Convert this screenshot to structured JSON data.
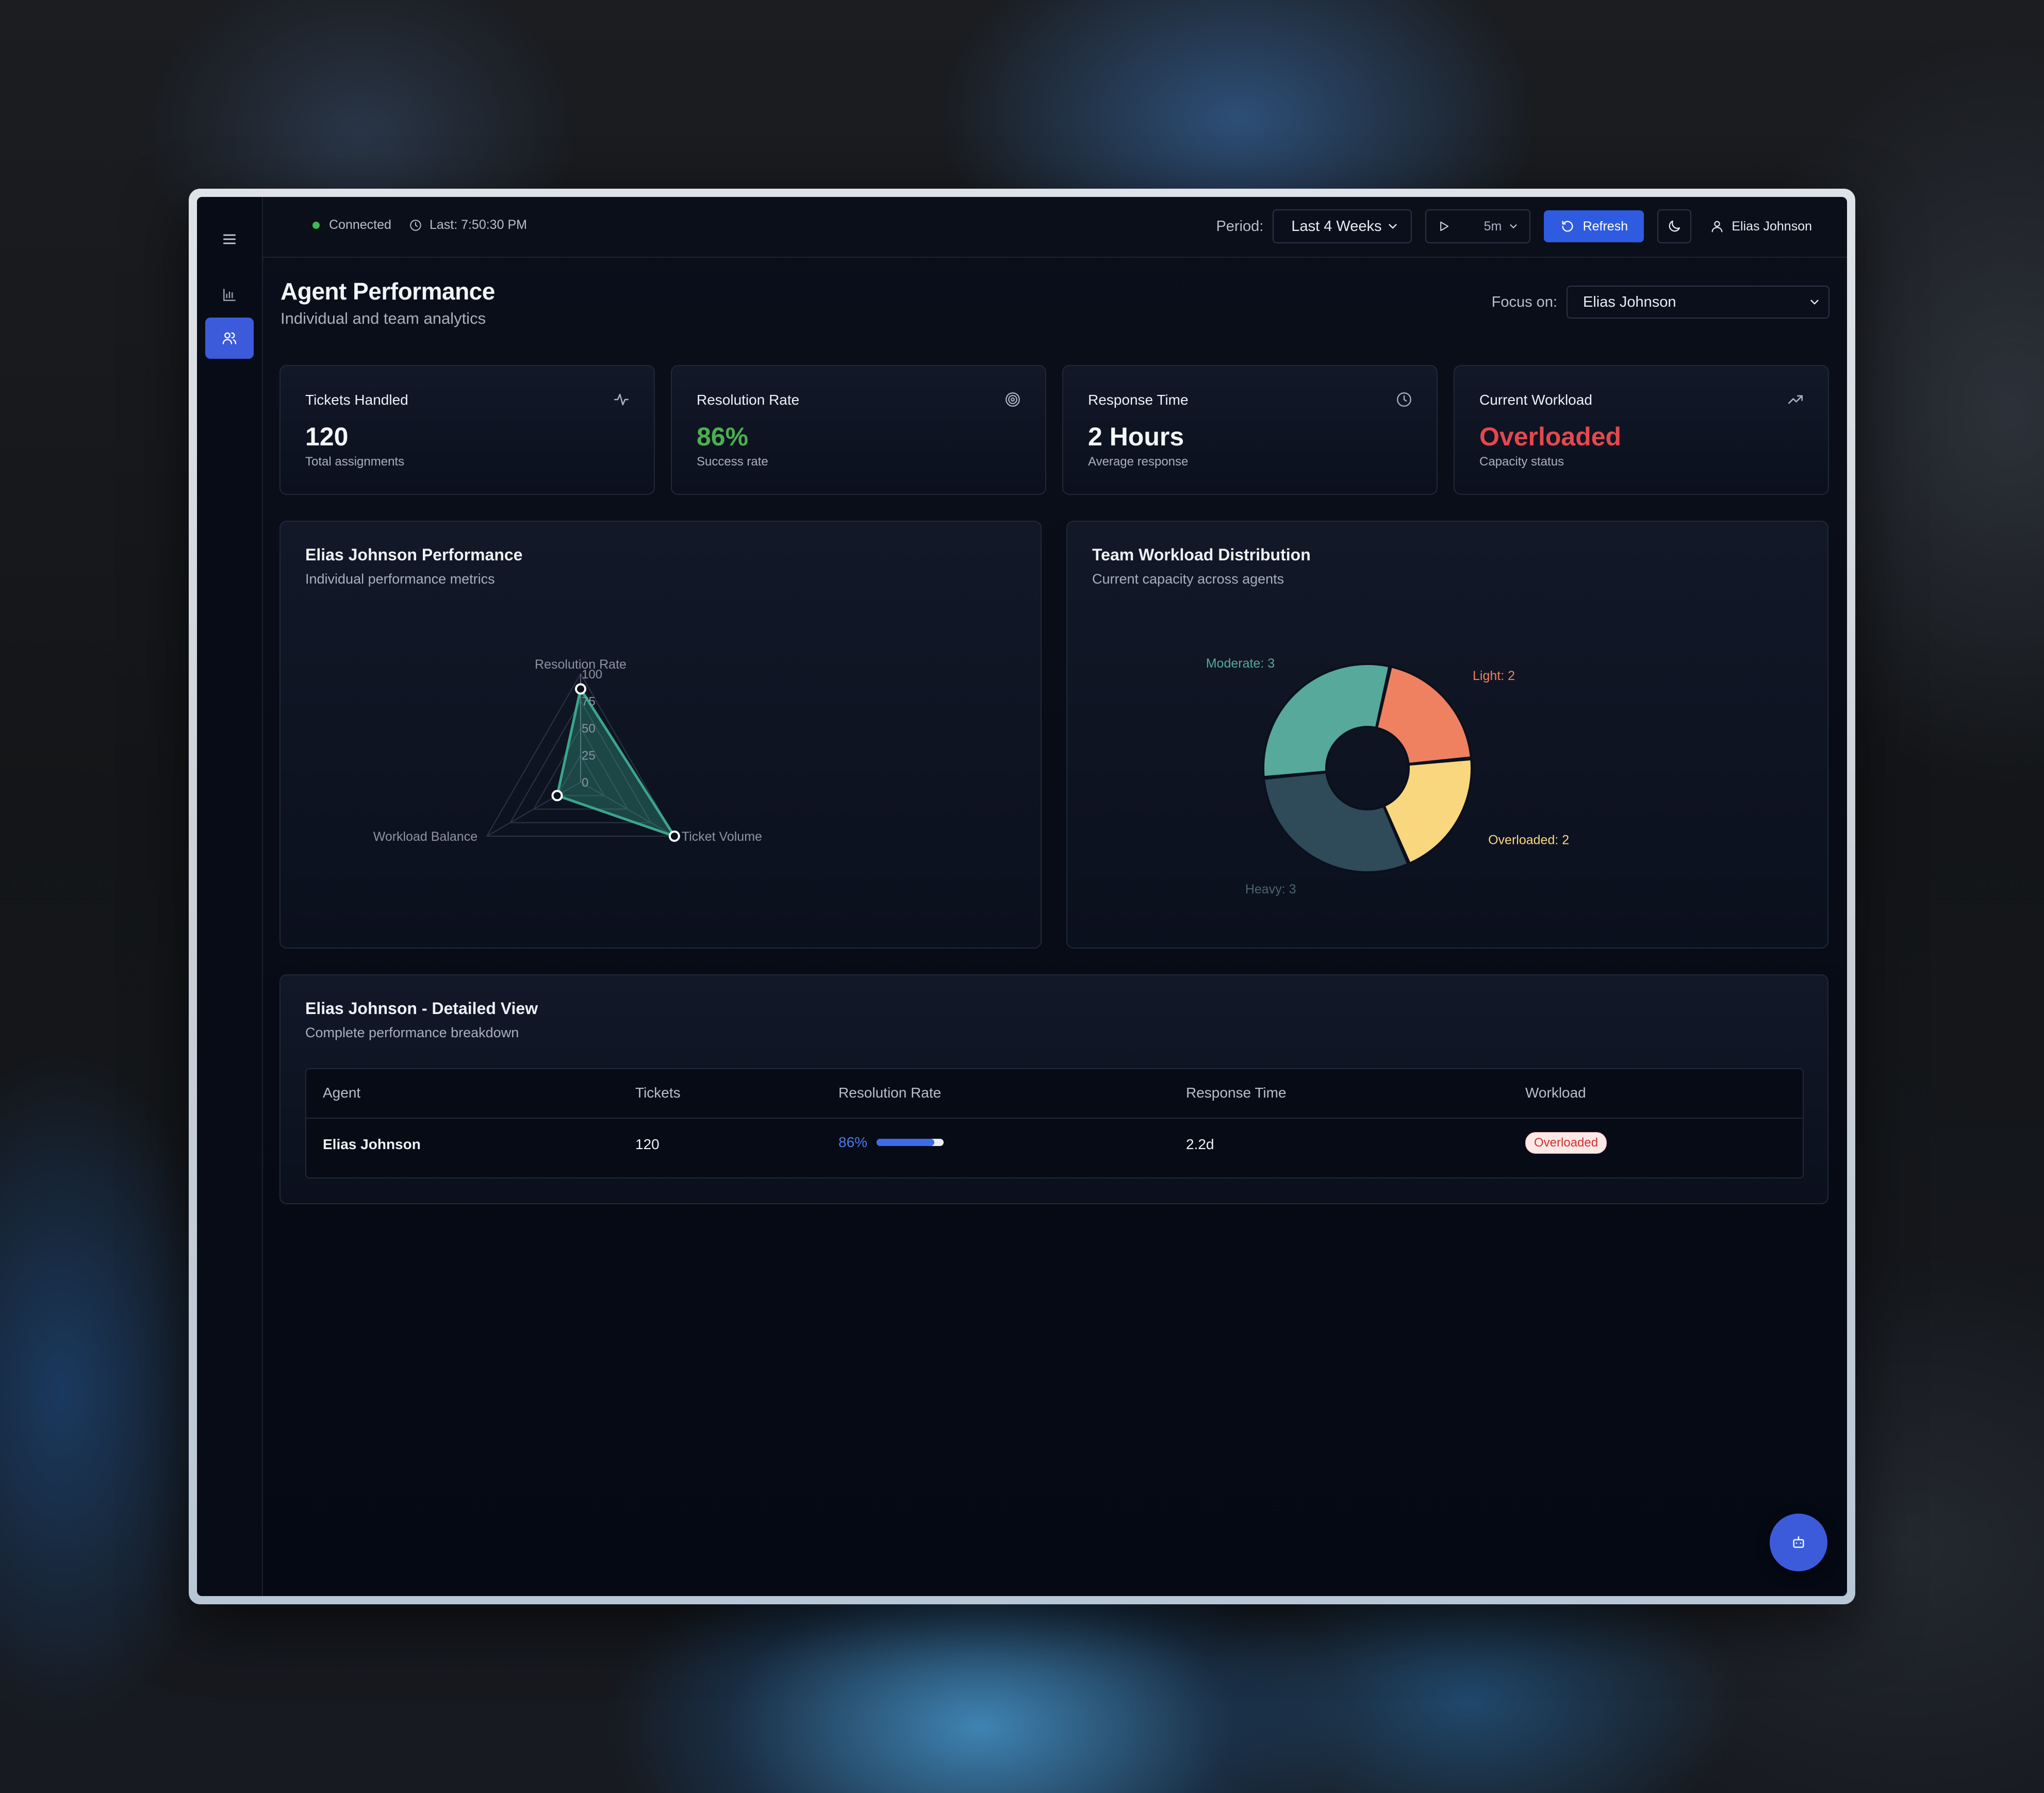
{
  "header": {
    "connection_status": "Connected",
    "last_updated": "Last: 7:50:30 PM",
    "period_label": "Period:",
    "period_value": "Last 4 Weeks",
    "auto_refresh_interval": "5m",
    "refresh_label": "Refresh",
    "user_name": "Elias Johnson"
  },
  "page": {
    "title": "Agent Performance",
    "subtitle": "Individual and team analytics",
    "focus_label": "Focus on:",
    "focus_value": "Elias Johnson"
  },
  "kpis": [
    {
      "title": "Tickets Handled",
      "value": "120",
      "desc": "Total assignments",
      "icon": "activity-icon",
      "color": "#f4f6f9"
    },
    {
      "title": "Resolution Rate",
      "value": "86%",
      "desc": "Success rate",
      "icon": "target-icon",
      "color": "#4caf50"
    },
    {
      "title": "Response Time",
      "value": "2 Hours",
      "desc": "Average response",
      "icon": "clock-icon",
      "color": "#f4f6f9"
    },
    {
      "title": "Current Workload",
      "value": "Overloaded",
      "desc": "Capacity status",
      "icon": "trending-up-icon",
      "color": "#e5484d"
    }
  ],
  "radar_card": {
    "title": "Elias Johnson Performance",
    "subtitle": "Individual performance metrics"
  },
  "donut_card": {
    "title": "Team Workload Distribution",
    "subtitle": "Current capacity across agents"
  },
  "chart_data": [
    {
      "type": "radar",
      "axes": [
        "Resolution Rate",
        "Ticket Volume",
        "Workload Balance"
      ],
      "ticks": [
        "0",
        "25",
        "50",
        "75",
        "100"
      ],
      "range": [
        0,
        100
      ],
      "series": [
        {
          "values": [
            86,
            100,
            25
          ],
          "color": "#3aa68b"
        }
      ]
    },
    {
      "type": "pie",
      "categories": [
        "Moderate",
        "Light",
        "Overloaded",
        "Heavy"
      ],
      "values": [
        3,
        2,
        2,
        3
      ],
      "labels": [
        "Moderate: 3",
        "Light: 2",
        "Overloaded: 2",
        "Heavy: 3"
      ],
      "colors": [
        "#56a99b",
        "#ef8160",
        "#f9d77e",
        "#2f4a58"
      ]
    }
  ],
  "detail": {
    "title": "Elias Johnson - Detailed View",
    "subtitle": "Complete performance breakdown",
    "columns": [
      "Agent",
      "Tickets",
      "Resolution Rate",
      "Response Time",
      "Workload"
    ],
    "rows": [
      {
        "agent": "Elias Johnson",
        "tickets": "120",
        "resolution_rate": "86%",
        "resolution_fraction": 0.86,
        "response_time": "2.2d",
        "workload": "Overloaded"
      }
    ]
  }
}
